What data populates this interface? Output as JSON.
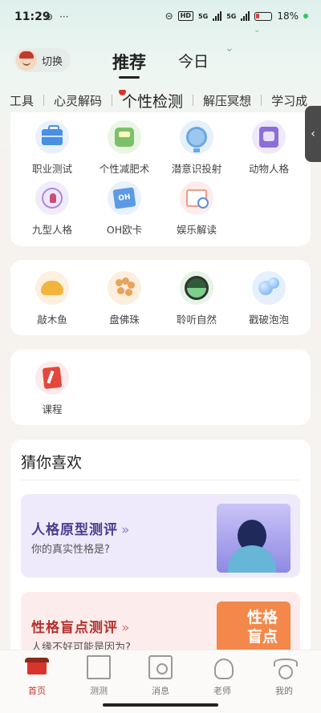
{
  "status_bar": {
    "time": "11:29",
    "hd_label": "HD",
    "net1": "5G",
    "net2": "5G",
    "battery": "18%"
  },
  "header": {
    "switch_label": "切换",
    "tabs": [
      {
        "label": "推荐",
        "active": true
      },
      {
        "label": "今日",
        "active": false
      }
    ]
  },
  "categories": [
    {
      "label": "工具"
    },
    {
      "label": "心灵解码"
    },
    {
      "label": "个性检测",
      "active": true
    },
    {
      "label": "解压冥想"
    },
    {
      "label": "学习成"
    }
  ],
  "section_personality": {
    "items": [
      {
        "label": "职业测试",
        "icon": "briefcase-icon"
      },
      {
        "label": "个性减肥术",
        "icon": "scale-icon"
      },
      {
        "label": "潜意识投射",
        "icon": "crystal-ball-icon"
      },
      {
        "label": "动物人格",
        "icon": "animal-card-icon"
      },
      {
        "label": "九型人格",
        "icon": "enneagram-icon"
      },
      {
        "label": "OH欧卡",
        "icon": "oh-card-icon"
      },
      {
        "label": "娱乐解读",
        "icon": "book-magnifier-icon"
      }
    ]
  },
  "section_relax": {
    "items": [
      {
        "label": "敲木鱼",
        "icon": "wooden-fish-icon"
      },
      {
        "label": "盘佛珠",
        "icon": "prayer-beads-icon"
      },
      {
        "label": "聆听自然",
        "icon": "nature-sound-icon"
      },
      {
        "label": "戳破泡泡",
        "icon": "bubble-icon"
      }
    ]
  },
  "section_course": {
    "items": [
      {
        "label": "课程",
        "icon": "course-icon"
      }
    ]
  },
  "guess": {
    "title": "猜你喜欢",
    "promos": [
      {
        "title": "人格原型测评",
        "arrow": "»",
        "subtitle": "你的真实性格是?"
      },
      {
        "title": "性格盲点测评",
        "arrow": "»",
        "subtitle": "人缘不好可能是因为?",
        "art_text_1": "性格",
        "art_text_2": "盲点"
      }
    ]
  },
  "bottom_nav": [
    {
      "label": "首页",
      "active": true
    },
    {
      "label": "测测",
      "active": false
    },
    {
      "label": "消息",
      "active": false
    },
    {
      "label": "老师",
      "active": false
    },
    {
      "label": "我的",
      "active": false
    }
  ],
  "colors": {
    "accent_red": "#d9342b",
    "promo1_title": "#4b3b8f",
    "promo2_title": "#b2312c"
  }
}
